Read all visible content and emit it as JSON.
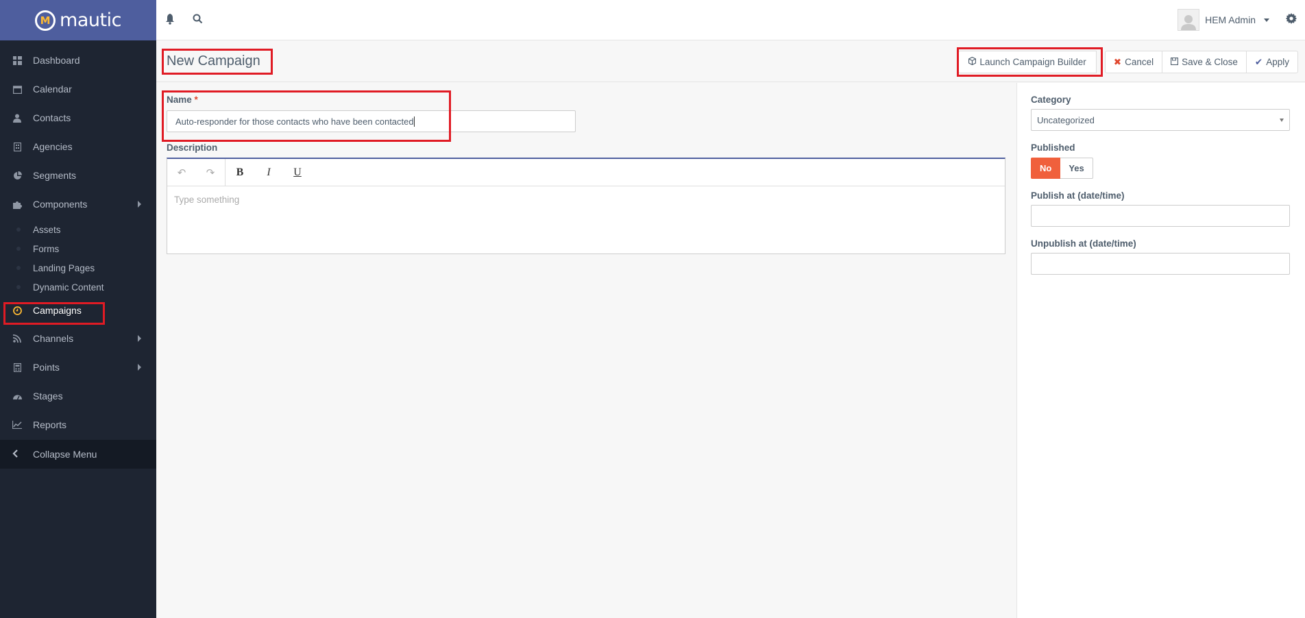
{
  "app": {
    "logo_text": "mautic"
  },
  "sidebar": {
    "items": [
      {
        "label": "Dashboard",
        "icon": "dashboard-icon"
      },
      {
        "label": "Calendar",
        "icon": "calendar-icon"
      },
      {
        "label": "Contacts",
        "icon": "user-icon"
      },
      {
        "label": "Agencies",
        "icon": "building-icon"
      },
      {
        "label": "Segments",
        "icon": "pie-chart-icon"
      },
      {
        "label": "Components",
        "icon": "puzzle-icon"
      }
    ],
    "sub_items": [
      "Assets",
      "Forms",
      "Landing Pages",
      "Dynamic Content"
    ],
    "items2": [
      {
        "label": "Campaigns",
        "icon": "clock-icon"
      },
      {
        "label": "Channels",
        "icon": "rss-icon"
      },
      {
        "label": "Points",
        "icon": "calculator-icon"
      },
      {
        "label": "Stages",
        "icon": "tachometer-icon"
      },
      {
        "label": "Reports",
        "icon": "line-chart-icon"
      }
    ],
    "collapse_label": "Collapse Menu"
  },
  "topbar": {
    "user_name": "HEM Admin"
  },
  "header": {
    "title": "New Campaign",
    "buttons": {
      "launch": "Launch Campaign Builder",
      "cancel": "Cancel",
      "save_close": "Save & Close",
      "apply": "Apply"
    }
  },
  "form": {
    "name_label": "Name",
    "required_mark": "*",
    "name_value": "Auto-responder for those contacts who have been contacted",
    "description_label": "Description",
    "description_placeholder": "Type something"
  },
  "right_panel": {
    "category_label": "Category",
    "category_value": "Uncategorized",
    "published_label": "Published",
    "published_no": "No",
    "published_yes": "Yes",
    "published_value": "No",
    "publish_at_label": "Publish at (date/time)",
    "unpublish_at_label": "Unpublish at (date/time)"
  },
  "colors": {
    "sidebar_bg": "#1e2532",
    "logo_bar_bg": "#4e5e9e",
    "accent_orange": "#f0603c",
    "highlight_red": "#e01b24",
    "active_icon": "#fdb933"
  }
}
